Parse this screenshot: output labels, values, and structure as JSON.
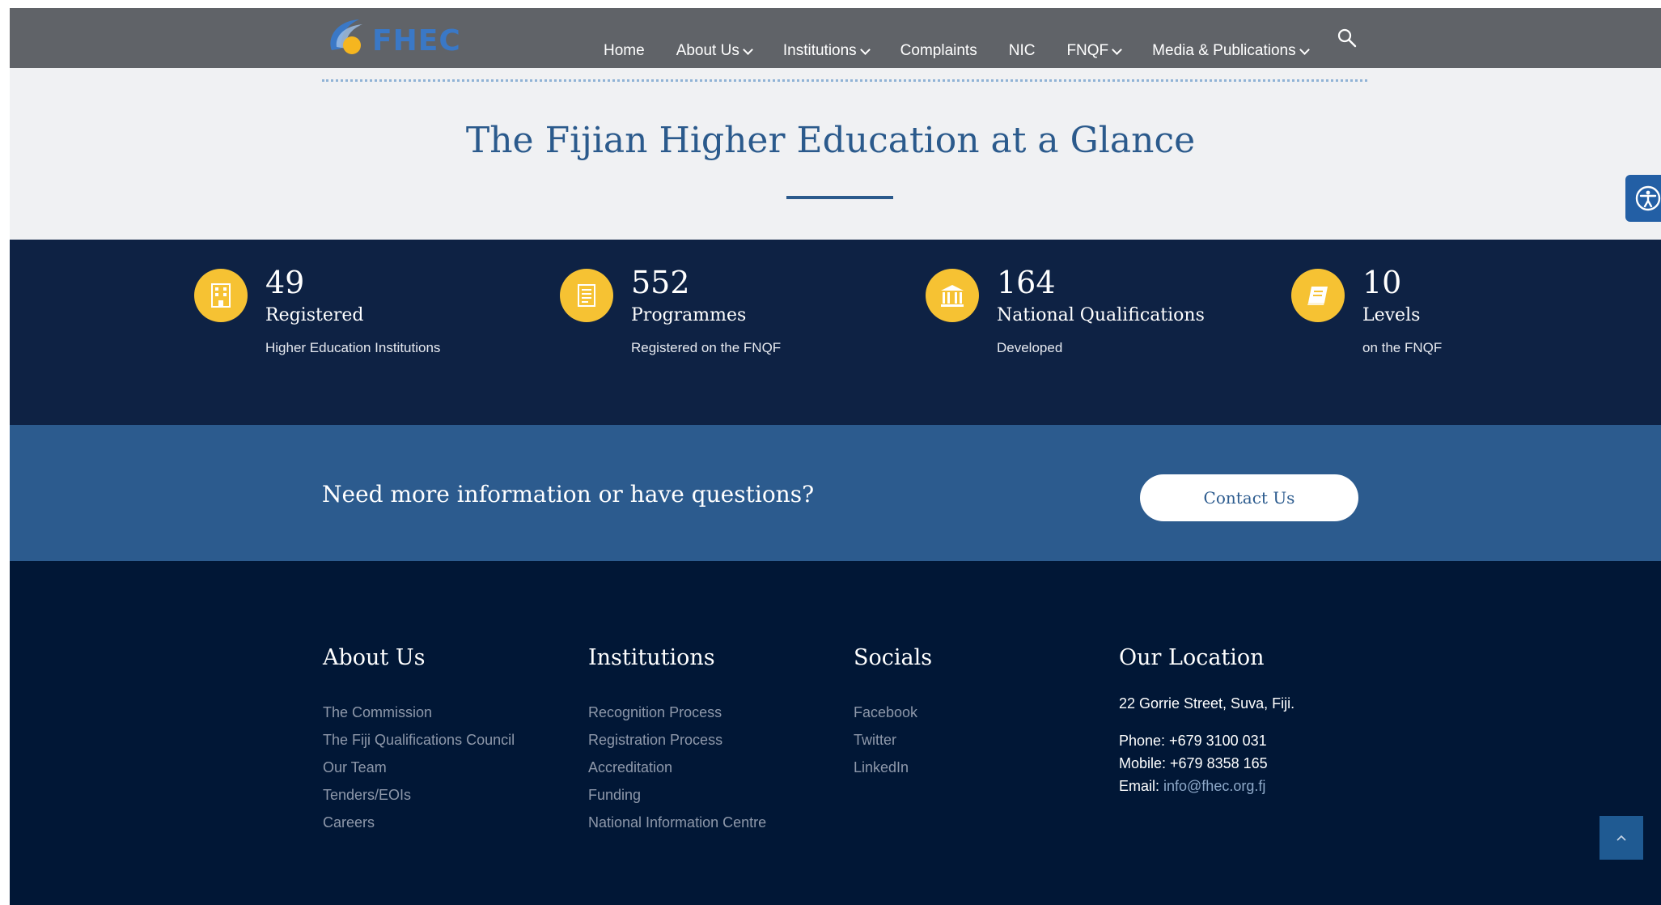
{
  "header": {
    "logo_text": "FHEC",
    "nav": [
      {
        "label": "Home",
        "dropdown": false
      },
      {
        "label": "About Us",
        "dropdown": true
      },
      {
        "label": "Institutions",
        "dropdown": true
      },
      {
        "label": "Complaints",
        "dropdown": false
      },
      {
        "label": "NIC",
        "dropdown": false
      },
      {
        "label": "FNQF",
        "dropdown": true
      },
      {
        "label": "Media & Publications",
        "dropdown": true
      }
    ],
    "search_icon": "search-icon"
  },
  "glance": {
    "title": "The Fijian Higher Education at a Glance"
  },
  "stats": [
    {
      "number": "49",
      "label": "Registered",
      "sub": "Higher Education Institutions",
      "icon": "building-icon"
    },
    {
      "number": "552",
      "label": "Programmes",
      "sub": "Registered on the FNQF",
      "icon": "document-icon"
    },
    {
      "number": "164",
      "label": "National Qualifications",
      "sub": "Developed",
      "icon": "institution-icon"
    },
    {
      "number": "10",
      "label": "Levels",
      "sub": "on the FNQF",
      "icon": "book-icon"
    }
  ],
  "cta": {
    "text": "Need more information or have questions?",
    "button": "Contact Us"
  },
  "footer": {
    "about": {
      "title": "About Us",
      "links": [
        "The Commission",
        "The Fiji Qualifications Council",
        "Our Team",
        "Tenders/EOIs",
        "Careers"
      ]
    },
    "institutions": {
      "title": "Institutions",
      "links": [
        "Recognition Process",
        "Registration Process",
        "Accreditation",
        "Funding",
        "National Information Centre"
      ]
    },
    "socials": {
      "title": "Socials",
      "links": [
        "Facebook",
        "Twitter",
        "LinkedIn"
      ]
    },
    "location": {
      "title": "Our Location",
      "address": "22 Gorrie Street, Suva, Fiji.",
      "phone": "Phone: +679 3100 031",
      "mobile": "Mobile: +679 8358 165",
      "email_label": "Email: ",
      "email": "info@fhec.org.fj"
    }
  },
  "colors": {
    "header_bg": "#606368",
    "title_blue": "#2b5a8c",
    "stats_bg": "#0e2244",
    "icon_yellow": "#f6c233",
    "cta_bg": "#2c5b8e",
    "footer_bg": "#011736",
    "logo_blue": "#3a78c6",
    "logo_sun": "#f6b61f"
  }
}
